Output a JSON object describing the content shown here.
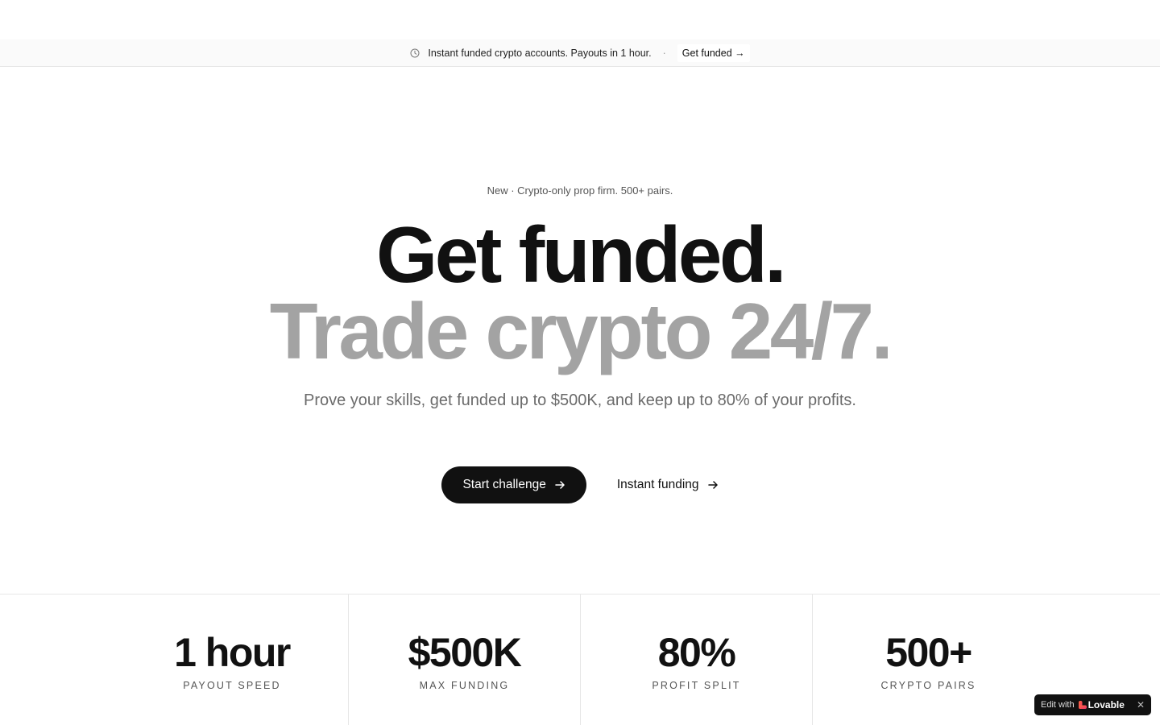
{
  "announcement": {
    "icon": "clock-icon",
    "text": "Instant funded crypto accounts. Payouts in 1 hour.",
    "separator": "·",
    "link_label": "Get funded →"
  },
  "hero": {
    "eyebrow": "New · Crypto-only prop firm. 500+ pairs.",
    "headline_primary": "Get funded.",
    "headline_secondary": "Trade crypto 24/7.",
    "subhead": "Prove your skills, get funded up to $500K, and keep up to 80% of your profits.",
    "primary_cta": "Start challenge",
    "secondary_cta": "Instant funding"
  },
  "stats": [
    {
      "value": "1 hour",
      "label": "PAYOUT SPEED"
    },
    {
      "value": "$500K",
      "label": "MAX FUNDING"
    },
    {
      "value": "80%",
      "label": "PROFIT SPLIT"
    },
    {
      "value": "500+",
      "label": "CRYPTO PAIRS"
    }
  ],
  "badge": {
    "prefix": "Edit with",
    "brand": "Lovable",
    "close": "✕"
  },
  "colors": {
    "primary_text": "#111111",
    "muted_headline": "#a3a3a3",
    "subtext": "#6b6b6b",
    "border": "#e6e6e6"
  }
}
